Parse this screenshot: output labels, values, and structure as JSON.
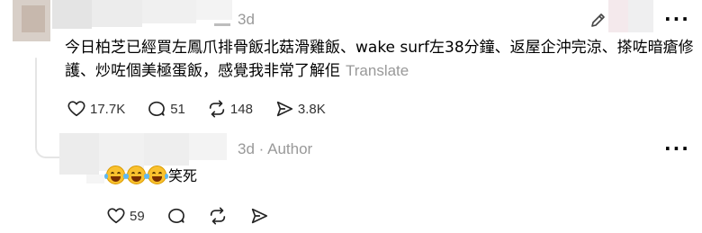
{
  "post": {
    "timestamp": "3d",
    "text": "今日柏芝已經買左鳳爪排骨飯北菇滑雞飯、wake surf左38分鐘、返屋企沖完涼、搽咗暗瘡修護、炒咗個美極蛋飯，感覺我非常了解佢",
    "translate_label": "Translate",
    "likes": "17.7K",
    "comments": "51",
    "reposts": "148",
    "shares": "3.8K"
  },
  "reply": {
    "timestamp": "3d",
    "author_tag": "Author",
    "text": "笑死",
    "likes": "59"
  },
  "colors": {
    "muted": "#999999",
    "thread_line": "#e5e5e5",
    "emoji_face": "#f9c12e"
  },
  "icons": [
    "edit-icon",
    "more-icon",
    "heart-icon",
    "comment-icon",
    "repost-icon",
    "share-icon",
    "laughing-emoji-icon"
  ]
}
